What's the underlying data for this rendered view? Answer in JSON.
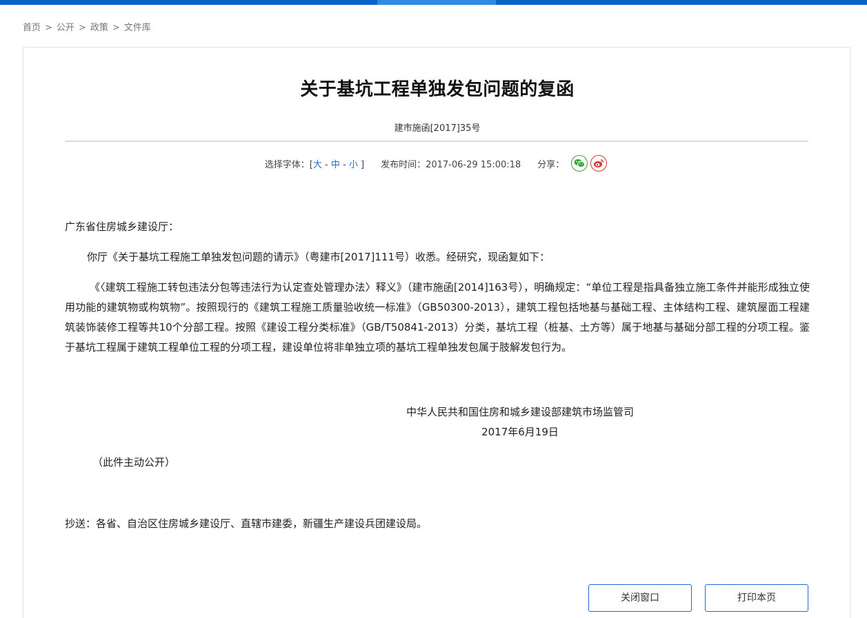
{
  "breadcrumb": {
    "items": [
      "首页",
      "公开",
      "政策",
      "文件库"
    ],
    "separator": ">"
  },
  "document": {
    "title": "关于基坑工程单独发包问题的复函",
    "doc_number": "建市施函[2017]35号"
  },
  "meta": {
    "font_select_prefix": "选择字体：[",
    "font_large": "大",
    "font_dash1": " - ",
    "font_medium": "中",
    "font_dash2": " - ",
    "font_small": "小",
    "font_select_suffix": " ]",
    "publish_label": "发布时间：",
    "publish_time": "2017-06-29 15:00:18",
    "share_label": "分享：",
    "share_icons": [
      "wechat-icon",
      "weibo-icon"
    ]
  },
  "body": {
    "addressee": "广东省住房城乡建设厅：",
    "paragraph1": "你厅《关于基坑工程施工单独发包问题的请示》（粤建市[2017]111号）收悉。经研究，现函复如下：",
    "paragraph2": "《〈建筑工程施工转包违法分包等违法行为认定查处管理办法〉释义》（建市施函[2014]163号），明确规定：“单位工程是指具备独立施工条件并能形成独立使用功能的建筑物或构筑物”。按照现行的《建筑工程施工质量验收统一标准》（GB50300-2013），建筑工程包括地基与基础工程、主体结构工程、建筑屋面工程建筑装饰装修工程等共10个分部工程。按照《建设工程分类标准》（GB/T50841-2013）分类，基坑工程（桩基、土方等）属于地基与基础分部工程的分项工程。鉴于基坑工程属于建筑工程单位工程的分项工程，建设单位将非单独立项的基坑工程单独发包属于肢解发包行为。",
    "signature_org": "中华人民共和国住房和城乡建设部建筑市场监管司",
    "signature_date": "2017年6月19日",
    "public_note": "（此件主动公开）",
    "cc": "抄送：各省、自治区住房城乡建设厅、直辖市建委，新疆生产建设兵团建设局。"
  },
  "buttons": {
    "close": "关闭窗口",
    "print": "打印本页"
  },
  "colors": {
    "top_bar": "#0a63c9",
    "top_bar_highlight": "#2f8ae4",
    "link": "#1a6dd8",
    "wechat": "#3aa43a",
    "weibo": "#e03232"
  }
}
